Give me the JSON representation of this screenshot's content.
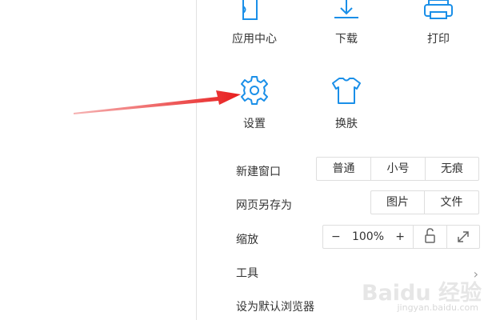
{
  "icon_color": "#1a8fe8",
  "arrow_color": "#e81e1e",
  "tiles": [
    {
      "label": "应用中心",
      "icon": "app-center-icon"
    },
    {
      "label": "下载",
      "icon": "download-icon"
    },
    {
      "label": "打印",
      "icon": "printer-icon"
    },
    {
      "label": "设置",
      "icon": "gear-icon"
    },
    {
      "label": "换肤",
      "icon": "tshirt-icon"
    }
  ],
  "new_window": {
    "label": "新建窗口",
    "options": [
      "普通",
      "小号",
      "无痕"
    ]
  },
  "save_as": {
    "label": "网页另存为",
    "options": [
      "图片",
      "文件"
    ]
  },
  "zoom": {
    "label": "缩放",
    "minus": "−",
    "value": "100%",
    "plus": "+"
  },
  "tools": {
    "label": "工具",
    "chevron": "›"
  },
  "default_browser": {
    "label": "设为默认浏览器"
  },
  "watermark": {
    "main": "Baidu 经验",
    "sub": "jingyan.baidu.com"
  }
}
